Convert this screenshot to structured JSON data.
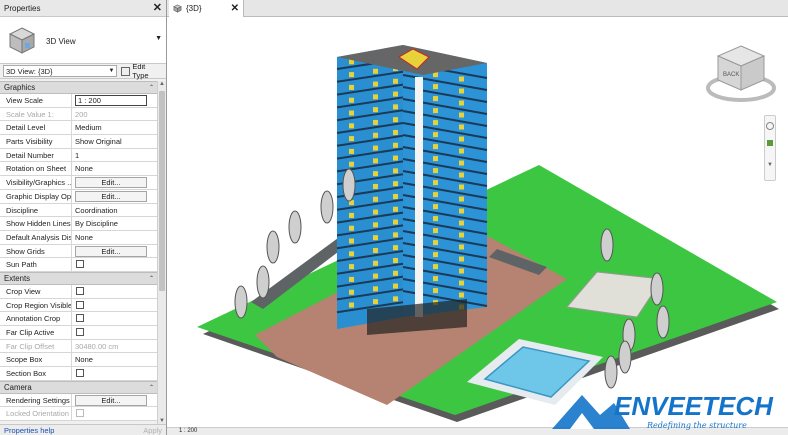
{
  "properties": {
    "title": "Properties",
    "type_name": "3D View",
    "view_selector": "3D View: {3D}",
    "edit_type": "Edit Type",
    "sections": [
      {
        "name": "Graphics",
        "rows": [
          {
            "label": "View Scale",
            "value": "1 : 200",
            "kind": "box"
          },
          {
            "label": "Scale Value    1:",
            "value": "200",
            "kind": "dim"
          },
          {
            "label": "Detail Level",
            "value": "Medium"
          },
          {
            "label": "Parts Visibility",
            "value": "Show Original"
          },
          {
            "label": "Detail Number",
            "value": "1"
          },
          {
            "label": "Rotation on Sheet",
            "value": "None"
          },
          {
            "label": "Visibility/Graphics ...",
            "value": "Edit...",
            "kind": "button"
          },
          {
            "label": "Graphic Display Opt...",
            "value": "Edit...",
            "kind": "button"
          },
          {
            "label": "Discipline",
            "value": "Coordination"
          },
          {
            "label": "Show Hidden Lines",
            "value": "By Discipline"
          },
          {
            "label": "Default Analysis Dis...",
            "value": "None"
          },
          {
            "label": "Show Grids",
            "value": "Edit...",
            "kind": "button"
          },
          {
            "label": "Sun Path",
            "value": "",
            "kind": "check"
          }
        ]
      },
      {
        "name": "Extents",
        "rows": [
          {
            "label": "Crop View",
            "value": "",
            "kind": "check"
          },
          {
            "label": "Crop Region Visible",
            "value": "",
            "kind": "check"
          },
          {
            "label": "Annotation Crop",
            "value": "",
            "kind": "check"
          },
          {
            "label": "Far Clip Active",
            "value": "",
            "kind": "check"
          },
          {
            "label": "Far Clip Offset",
            "value": "30480.00 cm",
            "kind": "dim"
          },
          {
            "label": "Scope Box",
            "value": "None"
          },
          {
            "label": "Section Box",
            "value": "",
            "kind": "check"
          }
        ]
      },
      {
        "name": "Camera",
        "rows": [
          {
            "label": "Rendering Settings",
            "value": "Edit...",
            "kind": "button"
          },
          {
            "label": "Locked Orientation",
            "value": "",
            "kind": "checkdim"
          }
        ]
      }
    ],
    "help_link": "Properties help",
    "apply": "Apply"
  },
  "view": {
    "tab_label": "{3D}",
    "viewcube_face": "BACK",
    "status_scale": "1 : 200"
  },
  "watermark": {
    "brand": "ENVEETECH",
    "tagline": "Redefining the structure"
  },
  "colors": {
    "tower_blue": "#2a8fd0",
    "tower_yellow": "#e8d23a",
    "plaza": "#b98572",
    "lawn": "#39c93f",
    "pool": "#6ec7e8"
  }
}
